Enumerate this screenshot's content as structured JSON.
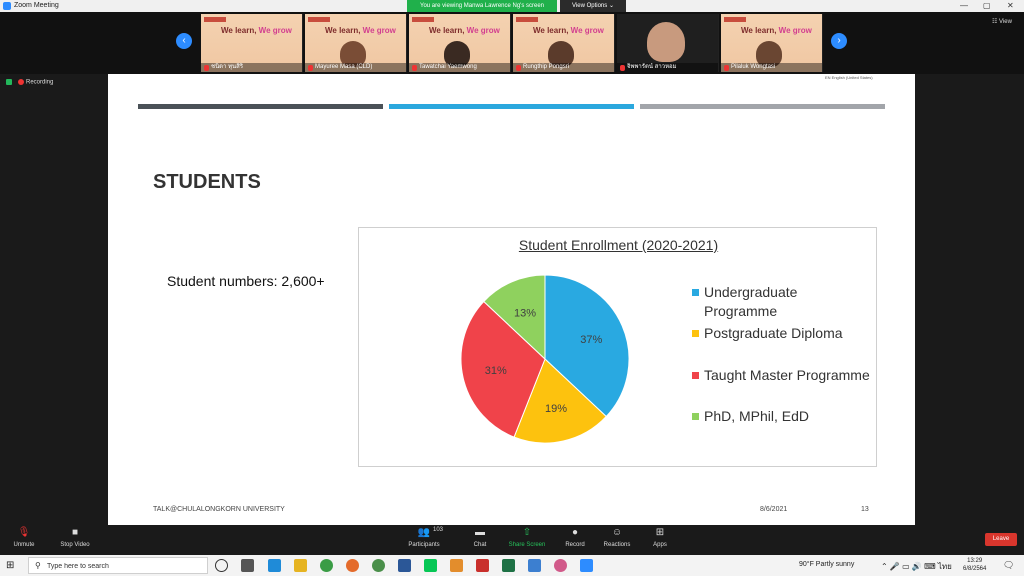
{
  "window": {
    "title": "Zoom Meeting",
    "min": "—",
    "max": "▢",
    "close": "✕"
  },
  "share_banner": "You are viewing Manwa Lawrence Ng's screen",
  "view_options": "View Options ⌄",
  "gallery": {
    "view_label": "☷ View",
    "prev": "‹",
    "next": "›",
    "slogan_a": "We learn, ",
    "slogan_b": "We grow",
    "participants": [
      "ชนิดา ทุนสิริ",
      "Mayuree Masa (CLD)",
      "Tawatchai Yaemwong",
      "Rungthip Pongsri",
      "จิพพารัตน์ สาวหอม",
      "Pilaluk Wongtasi"
    ]
  },
  "recording": "Recording",
  "slide": {
    "mini_caption": "EN English (United States)",
    "title": "STUDENTS",
    "student_numbers": "Student numbers: 2,600+",
    "footer_org": "TALK@CHULALONGKORN UNIVERSITY",
    "footer_date": "8/6/2021",
    "page_number": "13",
    "bar_colors": [
      "#4a5157",
      "#2ba8de",
      "#a2a5aa"
    ]
  },
  "chart_data": {
    "type": "pie",
    "title": "Student Enrollment (2020-2021)",
    "categories": [
      "Undergraduate Programme",
      "Postgraduate Diploma",
      "Taught Master Programme",
      "PhD, MPhil, EdD"
    ],
    "values": [
      37,
      19,
      31,
      13
    ],
    "labels": [
      "37%",
      "19%",
      "31%",
      "13%"
    ],
    "colors": [
      "#29a9e1",
      "#fdc20e",
      "#f0434a",
      "#8fd15e"
    ],
    "legend_placement": "right"
  },
  "controls": {
    "unmute": "Unmute",
    "stop_video": "Stop Video",
    "participants": "Participants",
    "participant_count": "103",
    "chat": "Chat",
    "share_screen": "Share Screen",
    "record": "Record",
    "reactions": "Reactions",
    "apps": "Apps",
    "leave": "Leave"
  },
  "taskbar": {
    "search_placeholder": "Type here to search",
    "weather": "90°F  Partly sunny",
    "tray": "⌃ 🎤 ▭ 🔊 ⌨ ไทย",
    "time": "13:29",
    "date": "6/8/2564",
    "notifications": "🗨"
  }
}
